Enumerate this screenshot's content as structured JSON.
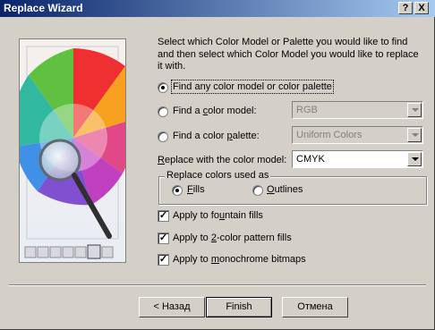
{
  "window": {
    "title": "Replace Wizard"
  },
  "title_buttons": {
    "help": "?",
    "close": "X"
  },
  "intro_text": "Select which Color Model or Palette you would like to find and then select which Color Model you would like to replace it with.",
  "find_options": {
    "any": {
      "label": "Find any color model or color palette",
      "selected": true
    },
    "model": {
      "label_pre": "Find a ",
      "label_u": "c",
      "label_post": "olor model:",
      "value": "RGB",
      "enabled": false
    },
    "palette": {
      "label_pre": "Find a color ",
      "label_u": "p",
      "label_post": "alette:",
      "value": "Uniform Colors",
      "enabled": false
    }
  },
  "replace_with": {
    "label_u": "R",
    "label_post": "eplace with the color model:",
    "value": "CMYK"
  },
  "replace_group": {
    "title": "Replace colors used as",
    "fills": {
      "label_u": "F",
      "label_post": "ills",
      "selected": true
    },
    "outlines": {
      "label_u": "O",
      "label_post": "utlines",
      "selected": false
    }
  },
  "checkboxes": [
    {
      "pre": "Apply to fo",
      "u": "u",
      "post": "ntain fills",
      "checked": true
    },
    {
      "pre": "Apply to ",
      "u": "2",
      "post": "-color pattern fills",
      "checked": true
    },
    {
      "pre": "Apply to ",
      "u": "m",
      "post": "onochrome bitmaps",
      "checked": true
    }
  ],
  "buttons": {
    "back": "Назад",
    "back_prefix": "< ",
    "finish": "Finish",
    "cancel": "Отмена"
  },
  "icon_names": [
    "color-wheel-magnifier-icon",
    "check-icon"
  ]
}
